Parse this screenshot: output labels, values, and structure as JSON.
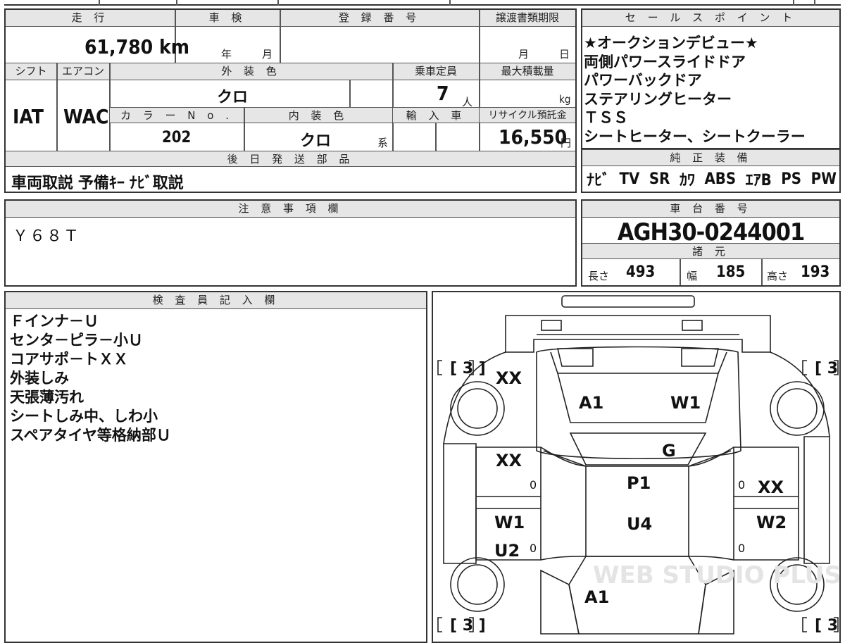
{
  "vehicle": {
    "mileage_header": "走 行",
    "mileage": "61,780 km",
    "shaken_header": "車 検",
    "shaken_year_unit": "年",
    "shaken_month_unit": "月",
    "registration_header": "登 録 番 号",
    "transfer_deadline_header": "譲渡書類期限",
    "transfer_month_unit": "月",
    "transfer_day_unit": "日",
    "shift_header": "シフト",
    "shift": "IAT",
    "aircon_header": "エアコン",
    "aircon": "WAC",
    "exterior_color_header": "外 装 色",
    "exterior_color": "クロ",
    "capacity_header": "乗車定員",
    "capacity": "7",
    "capacity_unit": "人",
    "max_load_header": "最大積載量",
    "max_load_unit": "kg",
    "color_no_header": "カ ラ ー N o .",
    "color_no": "202",
    "interior_color_header": "内 装 色",
    "interior_color": "クロ",
    "interior_color_suffix": "系",
    "import_header": "輸 入 車",
    "recycle_header": "リサイクル預託金",
    "recycle_fee": "16,550",
    "recycle_unit": "円",
    "later_parts_header": "後 日 発 送 部 品",
    "later_parts": "車両取説 予備ｷｰ ﾅﾋﾞ取説"
  },
  "sales_points": {
    "header": "セ ー ル ス ポ イ ン ト",
    "items": [
      "★オークションデビュー★",
      "両側パワースライドドア",
      "パワーバックドア",
      "ステアリングヒーター",
      "ＴＳＳ",
      "シートヒーター、シートクーラー"
    ]
  },
  "equipment": {
    "header": "純 正 装 備",
    "items": [
      "ﾅﾋﾞ",
      "TV",
      "SR",
      "ｶﾜ",
      "ABS",
      "ｴｱB",
      "PS",
      "PW"
    ]
  },
  "notes": {
    "header": "注 意 事 項 欄",
    "text": "Ｙ６８Ｔ"
  },
  "chassis": {
    "header": "車 台 番 号",
    "number": "AGH30-0244001",
    "specs_header": "諸 元",
    "length_label": "長さ",
    "length": "493",
    "width_label": "幅",
    "width": "185",
    "height_label": "高さ",
    "height": "193"
  },
  "inspector": {
    "header": "検 査 員 記 入 欄",
    "lines": [
      "Ｆインナ－Ｕ",
      "センタ－ピラ－小Ｕ",
      "コアサポ－トＸＸ",
      "外装しみ",
      "天張薄汚れ",
      "シートしみ中、しわ小",
      "スペアタイヤ等格納部Ｕ"
    ]
  },
  "diagram": {
    "tire_marks": [
      "[ 3 ]",
      "[ 3 ]",
      "[ 3 ]",
      "[ 3 ]"
    ],
    "damage_marks": [
      "XX",
      "A1",
      "W1",
      "G",
      "XX",
      "P1",
      "XX",
      "W1",
      "U4",
      "W2",
      "U2",
      "A1"
    ],
    "zero_marks": [
      "0",
      "0",
      "0",
      "0"
    ],
    "watermark": "WEB STUDIO PLUS"
  }
}
